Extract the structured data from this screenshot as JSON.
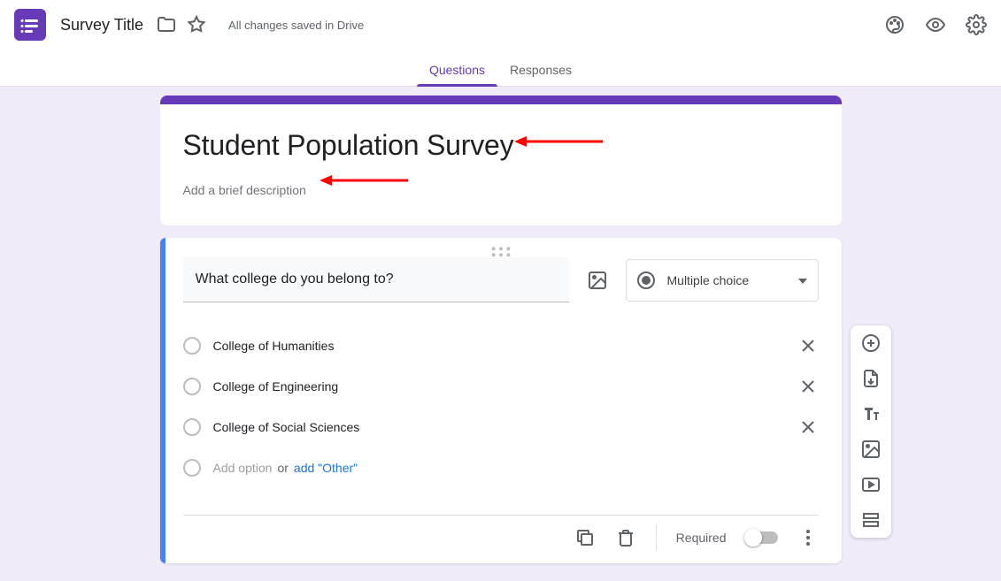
{
  "header": {
    "doc_title": "Survey Title",
    "save_state": "All changes saved in Drive"
  },
  "tabs": {
    "questions": "Questions",
    "responses": "Responses"
  },
  "form": {
    "title": "Student Population Survey",
    "description_placeholder": "Add a brief description"
  },
  "question": {
    "text": "What college do you belong to?",
    "type_label": "Multiple choice",
    "options": [
      "College of Humanities",
      "College of Engineering",
      "College of Social Sciences"
    ],
    "add_option_label": "Add option",
    "or_label": "or",
    "add_other_label": "add \"Other\"",
    "required_label": "Required"
  }
}
